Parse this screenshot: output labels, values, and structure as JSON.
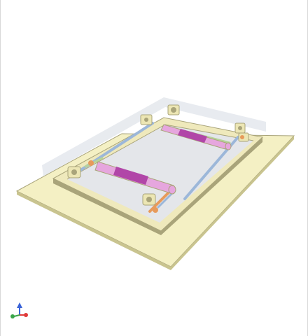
{
  "viewer": {
    "background": "#ffffff"
  },
  "colors": {
    "base_plate": "#f4f0c4",
    "base_plate_edge": "#c9c48f",
    "frame": "#efe9bc",
    "frame_edge": "#a9a47a",
    "cover_glass": "#d6dbe3",
    "inner_floor": "#e4e6ea",
    "roller": "#e6a6de",
    "roller_knurl": "#b146a8",
    "rod_blue": "#9cb7d9",
    "rod_orange": "#e79a5b",
    "rod_green": "#b6d39a",
    "bracket": "#ece6b4",
    "axis_x": "#e03a3a",
    "axis_y": "#3aa64a",
    "axis_z": "#3a63d8"
  },
  "triad": {
    "icons": [
      "triad-x-axis-icon",
      "triad-y-axis-icon",
      "triad-z-axis-icon"
    ]
  }
}
